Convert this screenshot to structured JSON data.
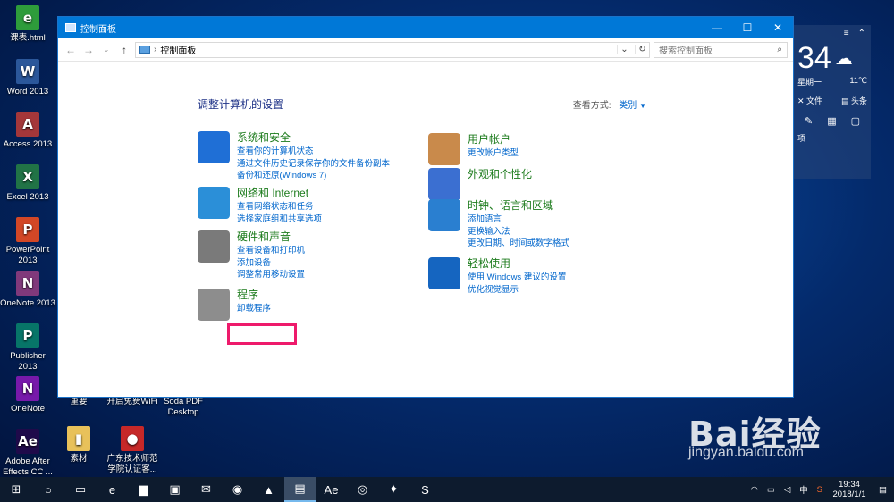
{
  "desktop": {
    "icons_left": [
      {
        "label": "课表.html",
        "icon": "html-file-icon",
        "color": "#2e9c3b",
        "glyph": "e"
      },
      {
        "label": "Word 2013",
        "icon": "word-icon",
        "color": "#2b579a",
        "glyph": "W"
      },
      {
        "label": "Access 2013",
        "icon": "access-icon",
        "color": "#a4373a",
        "glyph": "A"
      },
      {
        "label": "Excel 2013",
        "icon": "excel-icon",
        "color": "#217346",
        "glyph": "X"
      },
      {
        "label": "PowerPoint 2013",
        "icon": "powerpoint-icon",
        "color": "#d24726",
        "glyph": "P"
      },
      {
        "label": "OneNote 2013",
        "icon": "onenote-icon",
        "color": "#80397b",
        "glyph": "N"
      },
      {
        "label": "Publisher 2013",
        "icon": "publisher-icon",
        "color": "#077568",
        "glyph": "P"
      },
      {
        "label": "OneNote",
        "icon": "onenote-icon",
        "color": "#7719aa",
        "glyph": "N"
      },
      {
        "label": "Adobe After Effects CC ...",
        "icon": "after-effects-icon",
        "color": "#1f0a4a",
        "glyph": "Ae"
      }
    ],
    "icons_other": [
      {
        "label": "重要",
        "icon": "folder-icon",
        "color": "#c8a2c8",
        "glyph": "▣"
      },
      {
        "label": "开启免费WiFi",
        "icon": "wifi-app-icon",
        "color": "#3a7bd5",
        "glyph": "▤"
      },
      {
        "label": "Soda PDF Desktop",
        "icon": "soda-pdf-icon",
        "color": "#e53935",
        "glyph": "S"
      },
      {
        "label": "素材",
        "icon": "folder-icon",
        "color": "#e8c15a",
        "glyph": "▮"
      },
      {
        "label": "广东技术师范学院认证客...",
        "icon": "auth-client-icon",
        "color": "#c62828",
        "glyph": "●"
      }
    ]
  },
  "window": {
    "title": "控制面板",
    "address": "控制面板",
    "search_placeholder": "搜索控制面板",
    "page_title": "调整计算机的设置",
    "view_by_label": "查看方式:",
    "view_by_value": "类别",
    "categories_left": [
      {
        "title": "系统和安全",
        "icon": "shield-icon",
        "color": "#1f6fd6",
        "links": [
          "查看你的计算机状态",
          "通过文件历史记录保存你的文件备份副本",
          "备份和还原(Windows 7)"
        ]
      },
      {
        "title": "网络和 Internet",
        "icon": "network-icon",
        "color": "#2b8fd8",
        "links": [
          "查看网络状态和任务",
          "选择家庭组和共享选项"
        ]
      },
      {
        "title": "硬件和声音",
        "icon": "printer-icon",
        "color": "#7a7a7a",
        "links": [
          "查看设备和打印机",
          "添加设备",
          "调整常用移动设置"
        ]
      },
      {
        "title": "程序",
        "icon": "programs-icon",
        "color": "#8d8d8d",
        "links": [
          "卸载程序"
        ]
      }
    ],
    "categories_right": [
      {
        "title": "用户帐户",
        "icon": "users-icon",
        "color": "#c98a4b",
        "links": [
          "更改帐户类型"
        ]
      },
      {
        "title": "外观和个性化",
        "icon": "appearance-icon",
        "color": "#3b6fd1",
        "links": []
      },
      {
        "title": "时钟、语言和区域",
        "icon": "clock-globe-icon",
        "color": "#2a7fd0",
        "links": [
          "添加语言",
          "更换输入法",
          "更改日期、时间或数字格式"
        ]
      },
      {
        "title": "轻松使用",
        "icon": "ease-of-access-icon",
        "color": "#1565c0",
        "links": [
          "使用 Windows 建议的设置",
          "优化视觉显示"
        ]
      }
    ]
  },
  "weather": {
    "temp": "34",
    "day": "星期一",
    "low": "11℃",
    "btn1": "文件",
    "btn2": "头条",
    "more": "项"
  },
  "watermark": {
    "brand": "Bai经验",
    "url": "jingyan.baidu.com"
  },
  "taskbar": {
    "items": [
      {
        "icon": "windows-start-icon",
        "glyph": "⊞"
      },
      {
        "icon": "cortana-icon",
        "glyph": "○"
      },
      {
        "icon": "task-view-icon",
        "glyph": "▭"
      },
      {
        "icon": "edge-icon",
        "glyph": "e"
      },
      {
        "icon": "file-explorer-icon",
        "glyph": "▆"
      },
      {
        "icon": "store-icon",
        "glyph": "▣"
      },
      {
        "icon": "mail-icon",
        "glyph": "✉"
      },
      {
        "icon": "browser-360-icon",
        "glyph": "◉"
      },
      {
        "icon": "media-icon",
        "glyph": "▲"
      },
      {
        "icon": "control-panel-taskbar-icon",
        "glyph": "▤"
      },
      {
        "icon": "after-effects-taskbar-icon",
        "glyph": "Ae"
      },
      {
        "icon": "netease-music-icon",
        "glyph": "◎"
      },
      {
        "icon": "wechat-icon",
        "glyph": "✦"
      },
      {
        "icon": "sogou-icon",
        "glyph": "S"
      }
    ],
    "ime": "中",
    "time": "19:34",
    "date": "2018/1/1"
  }
}
